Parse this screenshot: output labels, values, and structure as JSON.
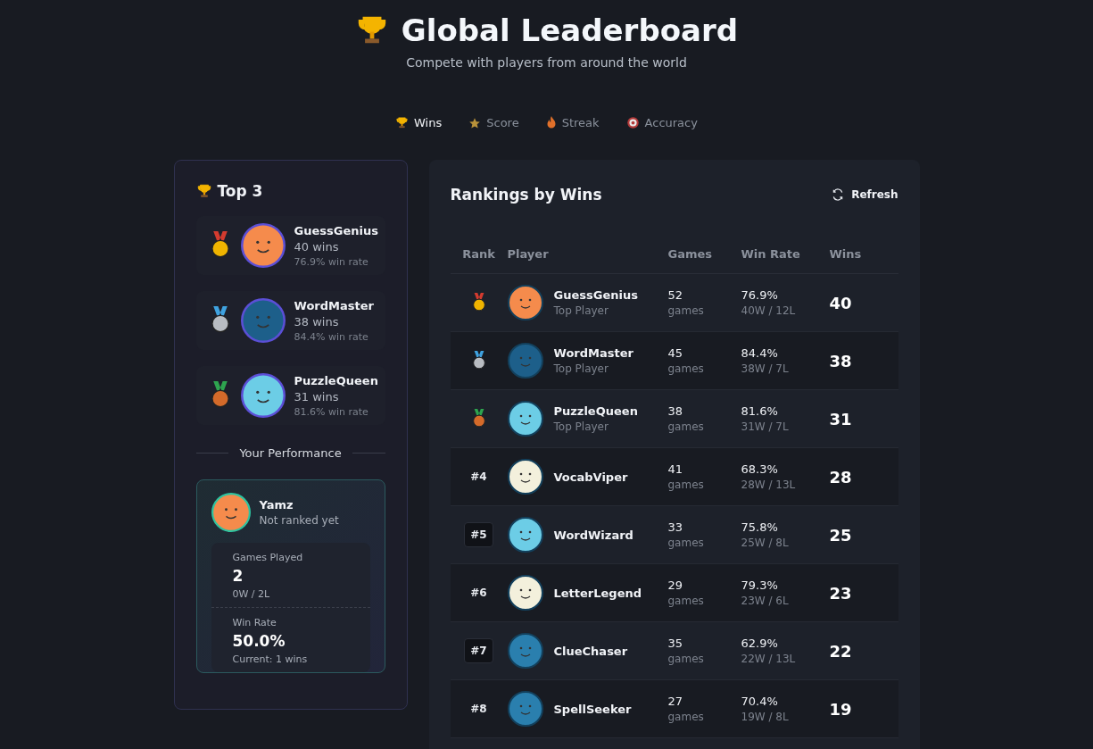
{
  "header": {
    "title": "Global Leaderboard",
    "subtitle": "Compete with players from around the world"
  },
  "tabs": [
    {
      "label": "Wins",
      "selected": true
    },
    {
      "label": "Score",
      "selected": false
    },
    {
      "label": "Streak",
      "selected": false
    },
    {
      "label": "Accuracy",
      "selected": false
    }
  ],
  "top3": {
    "title": "Top 3",
    "players": [
      {
        "name": "GuessGenius",
        "wins": "40 wins",
        "rate": "76.9% win rate",
        "color": "#f58b4c"
      },
      {
        "name": "WordMaster",
        "wins": "38 wins",
        "rate": "84.4% win rate",
        "color": "#1d5f8a"
      },
      {
        "name": "PuzzleQueen",
        "wins": "31 wins",
        "rate": "81.6% win rate",
        "color": "#6ccde6"
      }
    ]
  },
  "performance": {
    "title": "Your Performance",
    "name": "Yamz",
    "status": "Not ranked yet",
    "color": "#f58b4c",
    "stats": [
      {
        "label": "Games Played",
        "value": "2",
        "detail": "0W / 2L"
      },
      {
        "label": "Win Rate",
        "value": "50.0%",
        "detail": "Current: 1 wins"
      }
    ]
  },
  "rankings": {
    "title": "Rankings by Wins",
    "refresh": "Refresh",
    "columns": [
      "Rank",
      "Player",
      "Games",
      "Win Rate",
      "Wins"
    ],
    "rows": [
      {
        "kind": "medal",
        "name": "GuessGenius",
        "tag": "Top Player",
        "games": "52",
        "games_unit": "games",
        "rate": "76.9%",
        "record": "40W / 12L",
        "wins": "40",
        "color": "#f58b4c"
      },
      {
        "kind": "medal",
        "name": "WordMaster",
        "tag": "Top Player",
        "games": "45",
        "games_unit": "games",
        "rate": "84.4%",
        "record": "38W / 7L",
        "wins": "38",
        "color": "#1d5f8a"
      },
      {
        "kind": "medal",
        "name": "PuzzleQueen",
        "tag": "Top Player",
        "games": "38",
        "games_unit": "games",
        "rate": "81.6%",
        "record": "31W / 7L",
        "wins": "31",
        "color": "#6ccde6"
      },
      {
        "kind": "number",
        "rank": "#4",
        "boxed": false,
        "name": "VocabViper",
        "games": "41",
        "games_unit": "games",
        "rate": "68.3%",
        "record": "28W / 13L",
        "wins": "28",
        "color": "#f3f0dc"
      },
      {
        "kind": "number",
        "rank": "#5",
        "boxed": true,
        "name": "WordWizard",
        "games": "33",
        "games_unit": "games",
        "rate": "75.8%",
        "record": "25W / 8L",
        "wins": "25",
        "color": "#6ccde6"
      },
      {
        "kind": "number",
        "rank": "#6",
        "boxed": false,
        "name": "LetterLegend",
        "games": "29",
        "games_unit": "games",
        "rate": "79.3%",
        "record": "23W / 6L",
        "wins": "23",
        "color": "#f3f0dc"
      },
      {
        "kind": "number",
        "rank": "#7",
        "boxed": true,
        "name": "ClueChaser",
        "games": "35",
        "games_unit": "games",
        "rate": "62.9%",
        "record": "22W / 13L",
        "wins": "22",
        "color": "#2a7fae"
      },
      {
        "kind": "number",
        "rank": "#8",
        "boxed": false,
        "name": "SpellSeeker",
        "games": "27",
        "games_unit": "games",
        "rate": "70.4%",
        "record": "19W / 8L",
        "wins": "19",
        "color": "#2a7fae"
      }
    ]
  }
}
